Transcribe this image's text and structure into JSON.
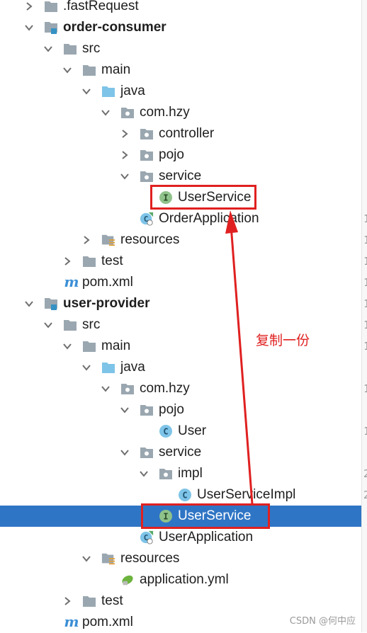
{
  "tree": {
    "fastrequest": ".fastRequest",
    "order_consumer": {
      "name": "order-consumer",
      "src": "src",
      "main": "main",
      "java": "java",
      "package": "com.hzy",
      "controller": "controller",
      "pojo": "pojo",
      "service": "service",
      "userservice": "UserService",
      "app": "OrderApplication",
      "resources": "resources",
      "test": "test",
      "pom": "pom.xml"
    },
    "user_provider": {
      "name": "user-provider",
      "src": "src",
      "main": "main",
      "java": "java",
      "package": "com.hzy",
      "pojo": "pojo",
      "user": "User",
      "service": "service",
      "impl": "impl",
      "userserviceimpl": "UserServiceImpl",
      "userservice": "UserService",
      "app": "UserApplication",
      "resources": "resources",
      "appyml": "application.yml",
      "test": "test",
      "pom": "pom.xml"
    }
  },
  "annotation": {
    "text": "复制一份"
  },
  "watermark": "CSDN @何中应",
  "gutter_digits": [
    "1",
    "1",
    "1",
    "1",
    "1",
    "1",
    "1",
    "1",
    "1",
    "2",
    "2"
  ],
  "colors": {
    "selection": "#2f75c5",
    "annotation": "#e02020",
    "folder": "#9aa7b0",
    "source_folder": "#7ec4e8",
    "interface_icon": "#8fc28a",
    "class_icon": "#7ec4e8"
  }
}
